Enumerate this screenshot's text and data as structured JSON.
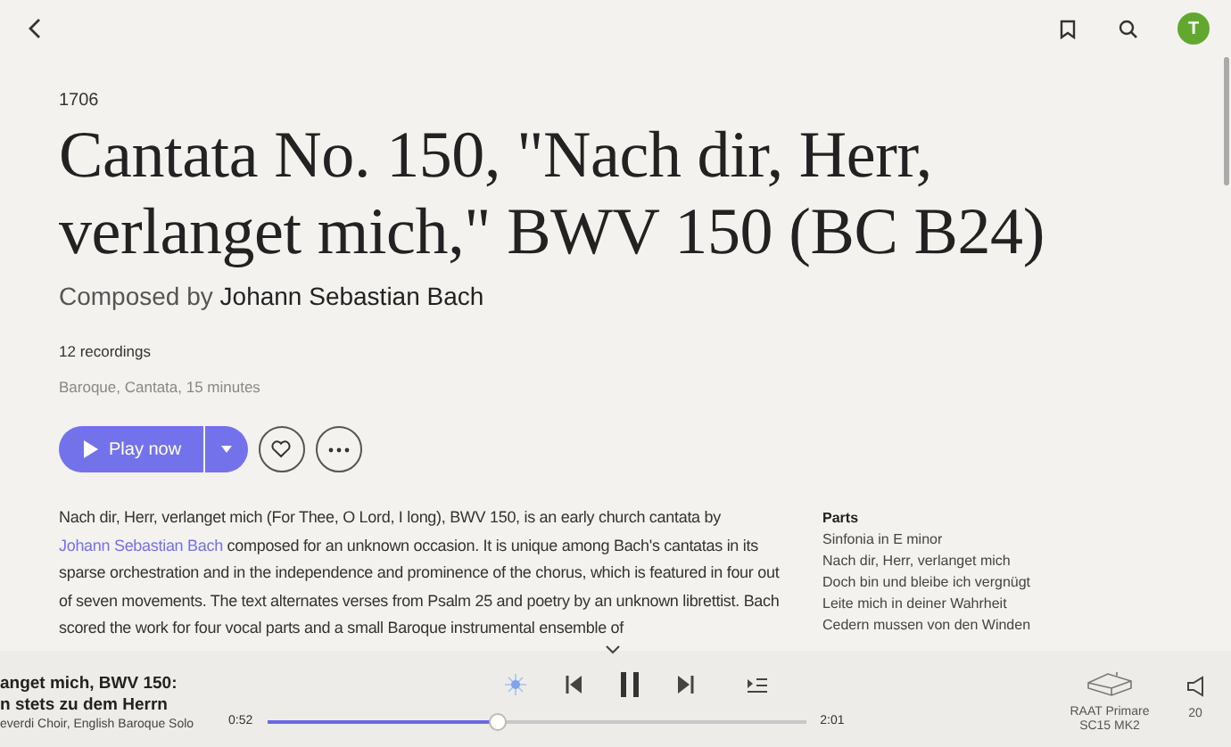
{
  "topbar": {
    "avatar": "T"
  },
  "work": {
    "year": "1706",
    "title": "Cantata No. 150, \"Nach dir, Herr, verlanget mich,\" BWV 150 (BC B24)",
    "composed_prefix": "Composed by",
    "composer": "Johann Sebastian Bach",
    "recordings": "12 recordings",
    "genre": "Baroque, Cantata, 15 minutes",
    "play_label": "Play now",
    "favorite": false
  },
  "description": {
    "link": "Johann Sebastian Bach",
    "before": "Nach dir, Herr, verlanget mich (For Thee, O Lord, I long), BWV 150, is an early church cantata by",
    "after": "composed for an unknown occasion. It is unique among Bach's cantatas in its sparse orchestration and in the independence and prominence of the chorus, which is featured in four out of seven movements. The text alternates verses from Psalm 25 and poetry by an unknown librettist. Bach scored the work for four vocal parts and a small Baroque instrumental ensemble of"
  },
  "parts": {
    "heading": "Parts",
    "items": [
      "Sinfonia in E minor",
      "Nach dir, Herr, verlanget mich",
      "Doch bin und bleibe ich vergnügt",
      "Leite mich in deiner Wahrheit",
      "Cedern mussen von den Winden"
    ]
  },
  "player": {
    "radio_on": true,
    "track_line_1": "anget mich, BWV 150:",
    "track_line_2": "n stets zu dem Herrn",
    "performers": "everdi Choir, English Baroque Solo",
    "playing": true,
    "elapsed": "0:52",
    "total": "2:01",
    "level": 0.43,
    "zone_line_1": "RAAT Primare",
    "zone_line_2": "SC15 MK2",
    "volume": "20"
  }
}
